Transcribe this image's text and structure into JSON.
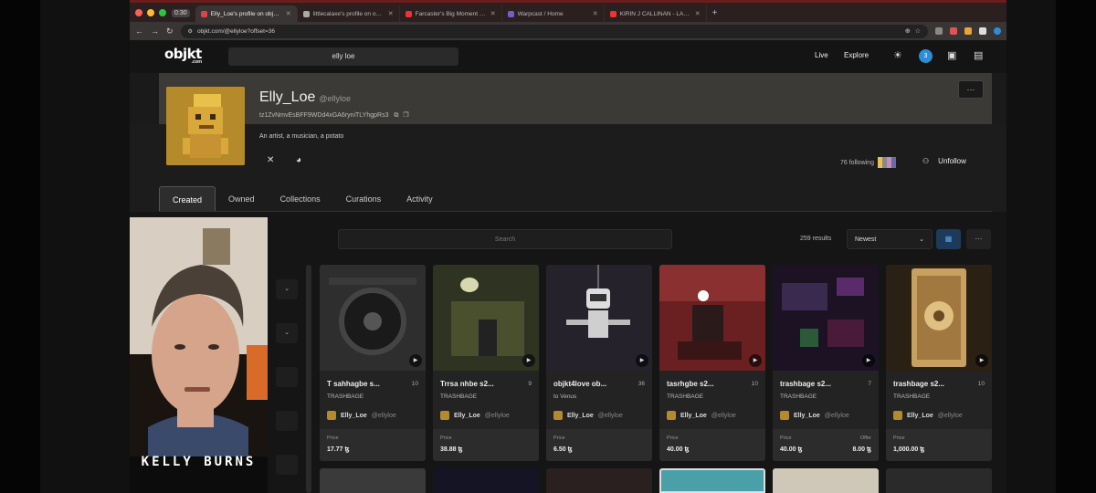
{
  "browser": {
    "time_badge": "0:30",
    "tabs": [
      {
        "title": "Elly_Loe's profile on objkt.c",
        "color": "#d44",
        "active": true
      },
      {
        "title": "littlecalaxe's profile on objkt",
        "color": "#aaa",
        "active": false
      },
      {
        "title": "Farcaster's Big Moment with",
        "color": "#e33",
        "active": false
      },
      {
        "title": "Warpcast / Home",
        "color": "#7a5cc6",
        "active": false
      },
      {
        "title": "KIRIN J CALLINAN - LANDS!",
        "color": "#e33",
        "active": false
      }
    ],
    "url": "objkt.com/@ellyloe?offset=36"
  },
  "site": {
    "logo": "objkt",
    "logo_sub": ".com",
    "search_value": "elly loe",
    "nav": [
      "Live",
      "Explore"
    ],
    "notification_count": "3"
  },
  "profile": {
    "name": "Elly_Loe",
    "handle": "@ellyloe",
    "address": "tz1ZvNmvEsBFF9WDd4xGA6ryniTLYhgpRs3",
    "bio": "An artist, a musician, a potato",
    "following": "76 following",
    "unfollow_label": "Unfollow",
    "more_label": "···"
  },
  "tabs": [
    "Created",
    "Owned",
    "Collections",
    "Curations",
    "Activity"
  ],
  "grid": {
    "search_placeholder": "Search",
    "results": "259 results",
    "sort": "Newest",
    "more_label": "···"
  },
  "cards": [
    {
      "title": "T sahhagbe s...",
      "editions": "10",
      "collection": "TRASHBAGE",
      "artist": "Elly_Loe",
      "handle": "@ellyloe",
      "price_label": "Price",
      "price": "17.77 ꜩ",
      "offer_label": "",
      "offer": "",
      "bg": "#2e2e2e"
    },
    {
      "title": "Trrsa nhbe s2...",
      "editions": "9",
      "collection": "TRASHBAGE",
      "artist": "Elly_Loe",
      "handle": "@ellyloe",
      "price_label": "Price",
      "price": "38.88 ꜩ",
      "offer_label": "",
      "offer": "",
      "bg": "#3a3d2a"
    },
    {
      "title": "objkt4love ob...",
      "editions": "36",
      "collection": "to Venus",
      "artist": "Elly_Loe",
      "handle": "@ellyloe",
      "price_label": "Price",
      "price": "6.50 ꜩ",
      "offer_label": "",
      "offer": "",
      "bg": "#2a2630"
    },
    {
      "title": "tasrhgbe s2...",
      "editions": "10",
      "collection": "TRASHBAGE",
      "artist": "Elly_Loe",
      "handle": "@ellyloe",
      "price_label": "Price",
      "price": "40.00 ꜩ",
      "offer_label": "",
      "offer": "",
      "bg": "#6a2020"
    },
    {
      "title": "trashbage s2...",
      "editions": "7",
      "collection": "TRASHBAGE",
      "artist": "Elly_Loe",
      "handle": "@ellyloe",
      "price_label": "Price",
      "price": "40.00 ꜩ",
      "offer_label": "Offer",
      "offer": "8.00 ꜩ",
      "bg": "#26182e"
    },
    {
      "title": "trashbage s2...",
      "editions": "10",
      "collection": "TRASHBAGE",
      "artist": "Elly_Loe",
      "handle": "@ellyloe",
      "price_label": "Price",
      "price": "1,000.00 ꜩ",
      "offer_label": "",
      "offer": "",
      "bg": "#3a2e1c"
    }
  ],
  "webcam": {
    "label": "KELLY BURNS"
  }
}
